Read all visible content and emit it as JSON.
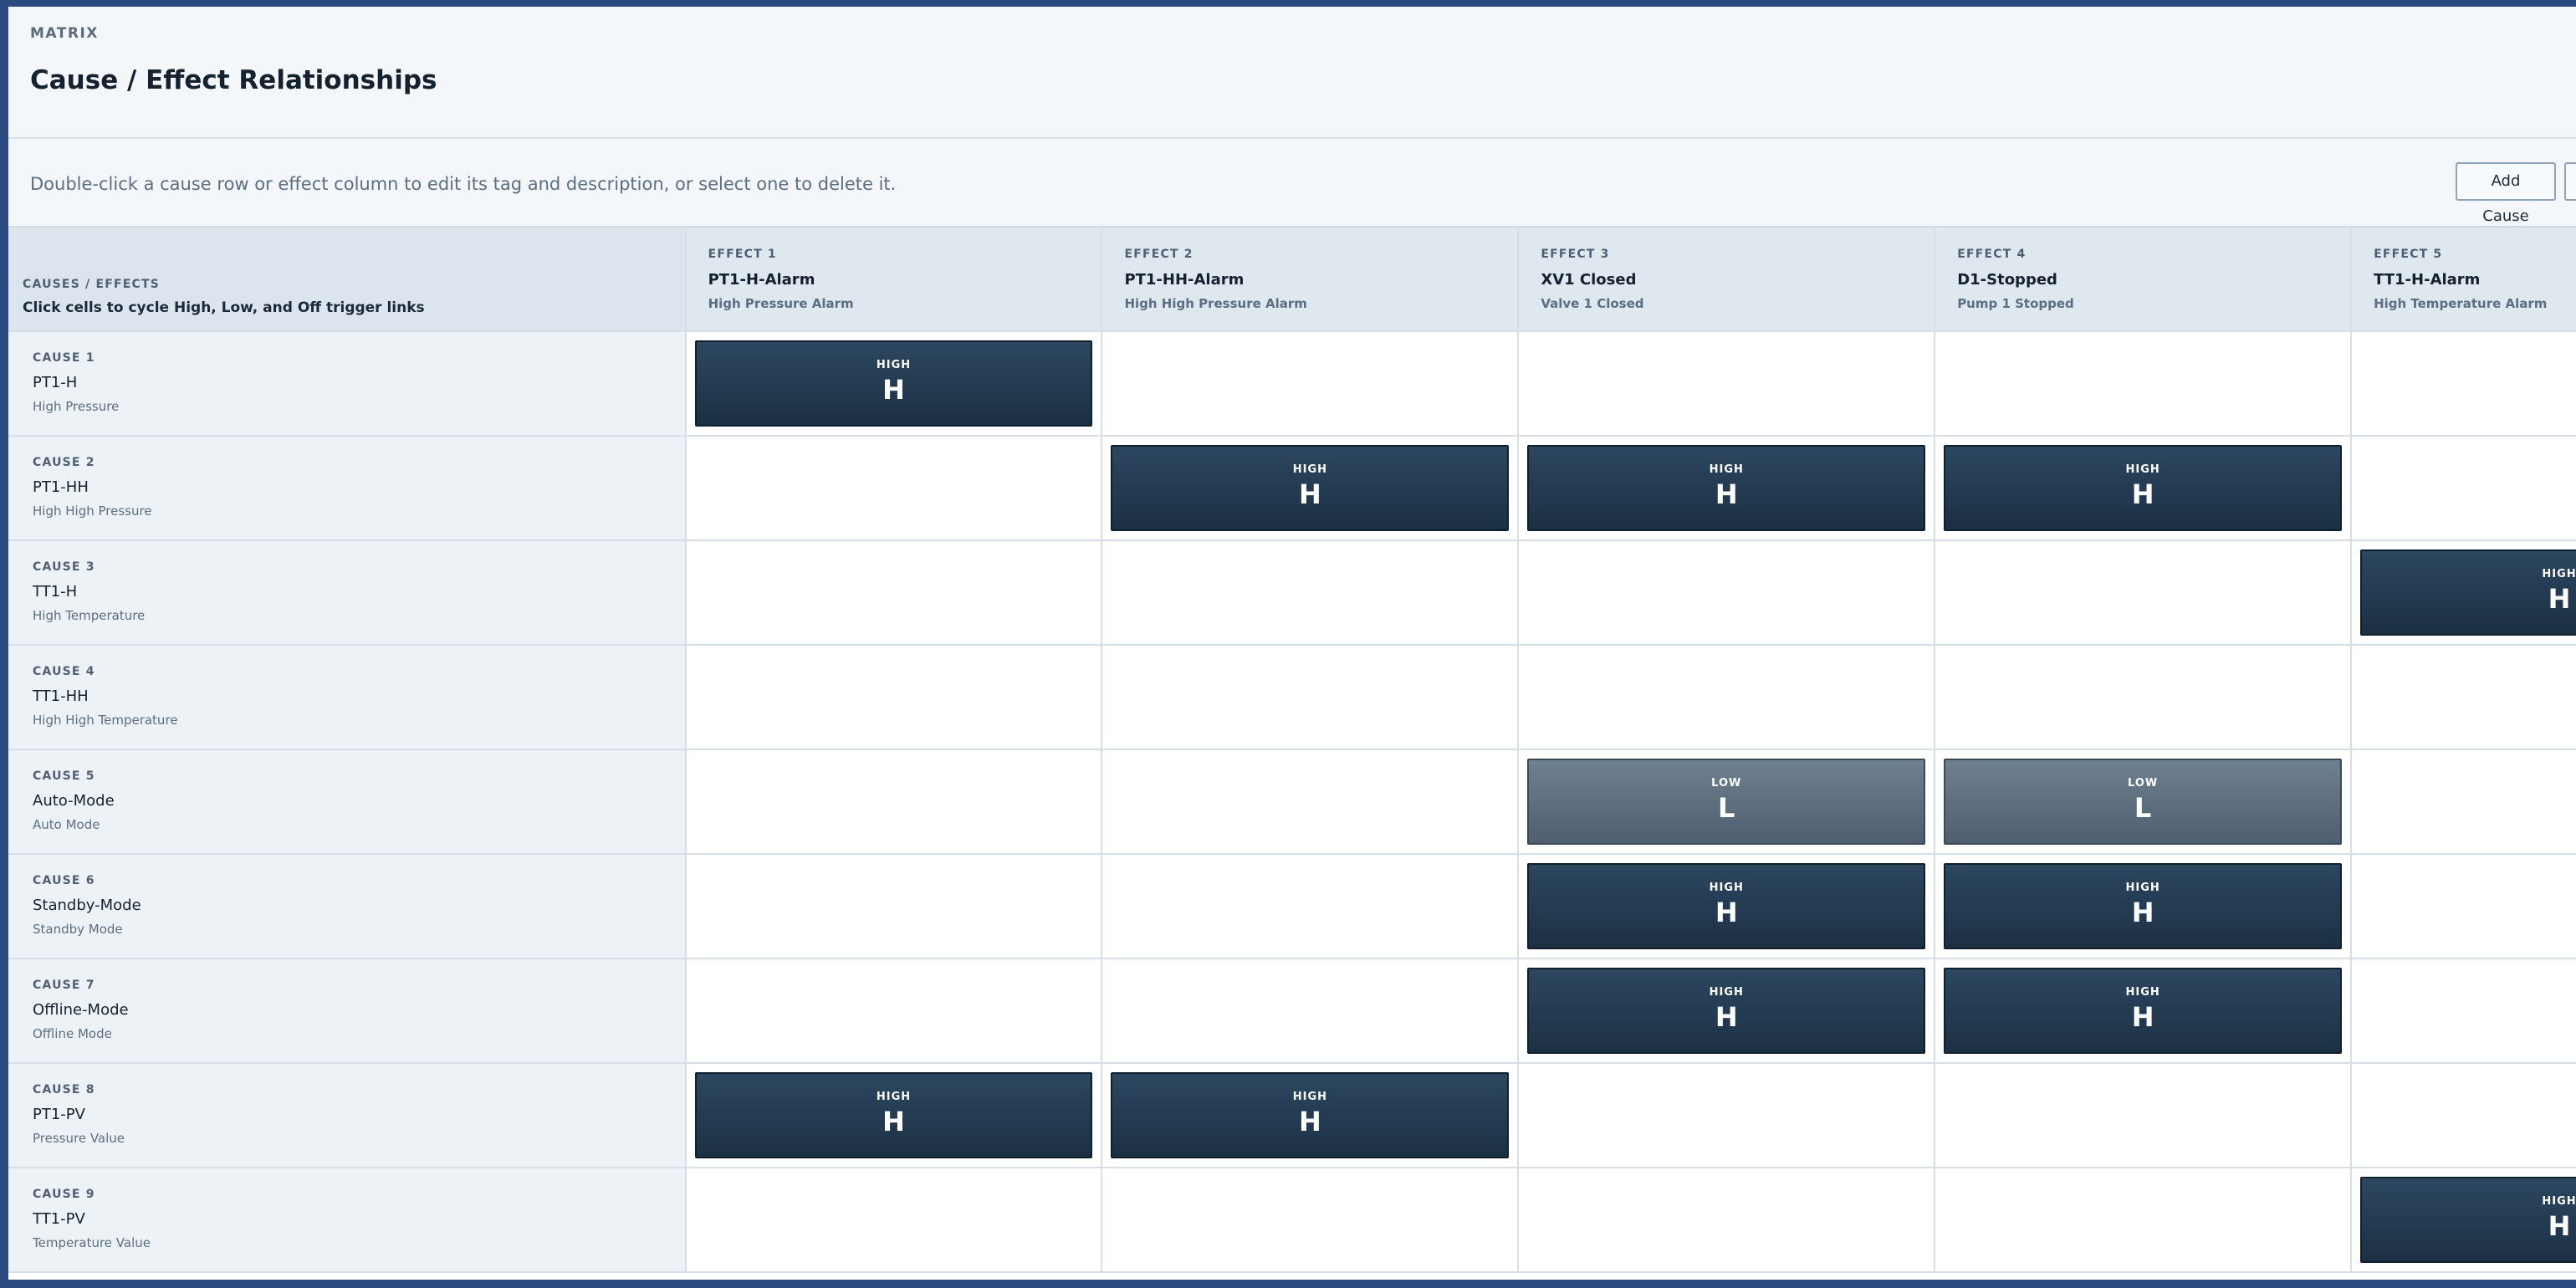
{
  "header": {
    "eyebrow": "MATRIX",
    "title": "Cause / Effect Relationships"
  },
  "toolbar": {
    "hint": "Double-click a cause row or effect column to edit its tag and description, or select one to delete it.",
    "add_cause_label": "Add Cause",
    "second_button_label": ""
  },
  "corner": {
    "kicker": "CAUSES / EFFECTS",
    "text": "Click cells to cycle High, Low, and Off trigger links"
  },
  "effects": [
    {
      "kicker": "EFFECT 1",
      "tag": "PT1-H-Alarm",
      "desc": "High Pressure Alarm"
    },
    {
      "kicker": "EFFECT 2",
      "tag": "PT1-HH-Alarm",
      "desc": "High High Pressure Alarm"
    },
    {
      "kicker": "EFFECT 3",
      "tag": "XV1 Closed",
      "desc": "Valve 1 Closed"
    },
    {
      "kicker": "EFFECT 4",
      "tag": "D1-Stopped",
      "desc": "Pump 1 Stopped"
    },
    {
      "kicker": "EFFECT 5",
      "tag": "TT1-H-Alarm",
      "desc": "High Temperature Alarm"
    }
  ],
  "causes": [
    {
      "kicker": "CAUSE 1",
      "tag": "PT1-H",
      "desc": "High Pressure",
      "links": [
        "H",
        "",
        "",
        "",
        ""
      ]
    },
    {
      "kicker": "CAUSE 2",
      "tag": "PT1-HH",
      "desc": "High High Pressure",
      "links": [
        "",
        "H",
        "H",
        "H",
        ""
      ]
    },
    {
      "kicker": "CAUSE 3",
      "tag": "TT1-H",
      "desc": "High Temperature",
      "links": [
        "",
        "",
        "",
        "",
        "H"
      ]
    },
    {
      "kicker": "CAUSE 4",
      "tag": "TT1-HH",
      "desc": "High High Temperature",
      "links": [
        "",
        "",
        "",
        "",
        ""
      ]
    },
    {
      "kicker": "CAUSE 5",
      "tag": "Auto-Mode",
      "desc": "Auto Mode",
      "links": [
        "",
        "",
        "L",
        "L",
        ""
      ]
    },
    {
      "kicker": "CAUSE 6",
      "tag": "Standby-Mode",
      "desc": "Standby Mode",
      "links": [
        "",
        "",
        "H",
        "H",
        ""
      ]
    },
    {
      "kicker": "CAUSE 7",
      "tag": "Offline-Mode",
      "desc": "Offline Mode",
      "links": [
        "",
        "",
        "H",
        "H",
        ""
      ]
    },
    {
      "kicker": "CAUSE 8",
      "tag": "PT1-PV",
      "desc": "Pressure Value",
      "links": [
        "H",
        "H",
        "",
        "",
        ""
      ]
    },
    {
      "kicker": "CAUSE 9",
      "tag": "TT1-PV",
      "desc": "Temperature Value",
      "links": [
        "",
        "",
        "",
        "",
        "H"
      ]
    }
  ],
  "link_labels": {
    "H": "HIGH",
    "L": "LOW"
  },
  "colors": {
    "high": "#1c3044",
    "low": "#4e5e6e",
    "background": "#2b4a80"
  }
}
